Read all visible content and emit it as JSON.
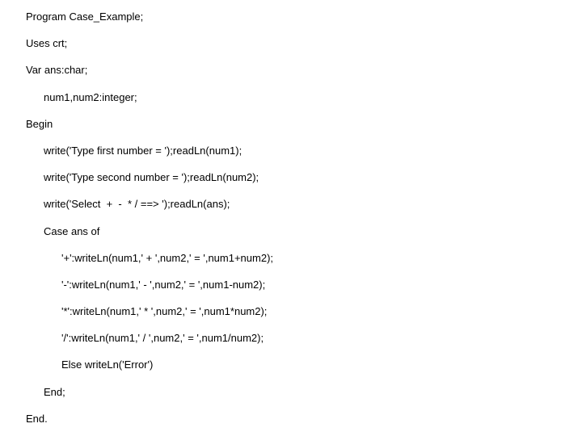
{
  "code": {
    "line1": "Program Case_Example;",
    "line2": "Uses crt;",
    "line3": "Var ans:char;",
    "line4": "num1,num2:integer;",
    "line5": "Begin",
    "line6": "write('Type first number = ');readLn(num1);",
    "line7": "write('Type second number = ');readLn(num2);",
    "line8": "write('Select  +  -  * / ==> ');readLn(ans);",
    "line9": "Case ans of",
    "line10": "'+':writeLn(num1,' + ',num2,' = ',num1+num2);",
    "line11": "'-':writeLn(num1,' - ',num2,' = ',num1-num2);",
    "line12": "'*':writeLn(num1,' * ',num2,' = ',num1*num2);",
    "line13": "'/':writeLn(num1,' / ',num2,' = ',num1/num2);",
    "line14": "Else writeLn('Error')",
    "line15": "End;",
    "line16": "End."
  }
}
